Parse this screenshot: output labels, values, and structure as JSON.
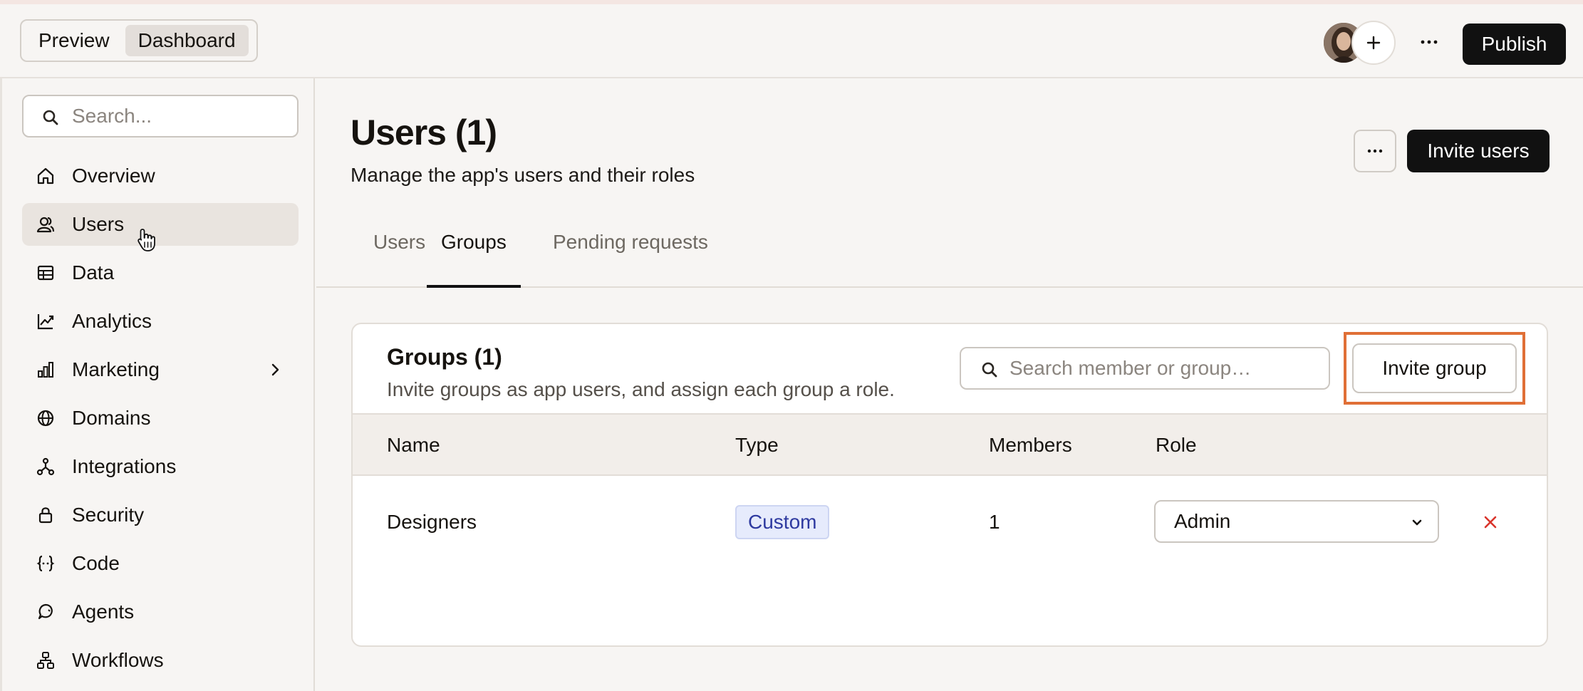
{
  "topbar": {
    "modes": [
      {
        "label": "Preview",
        "active": false
      },
      {
        "label": "Dashboard",
        "active": true
      }
    ],
    "publish_label": "Publish"
  },
  "sidebar": {
    "search_placeholder": "Search...",
    "items": [
      {
        "label": "Overview",
        "icon": "home-icon",
        "active": false
      },
      {
        "label": "Users",
        "icon": "users-icon",
        "active": true
      },
      {
        "label": "Data",
        "icon": "data-icon",
        "active": false
      },
      {
        "label": "Analytics",
        "icon": "analytics-icon",
        "active": false
      },
      {
        "label": "Marketing",
        "icon": "marketing-icon",
        "active": false,
        "has_submenu": true
      },
      {
        "label": "Domains",
        "icon": "globe-icon",
        "active": false
      },
      {
        "label": "Integrations",
        "icon": "integrations-icon",
        "active": false
      },
      {
        "label": "Security",
        "icon": "lock-icon",
        "active": false
      },
      {
        "label": "Code",
        "icon": "code-icon",
        "active": false
      },
      {
        "label": "Agents",
        "icon": "agents-icon",
        "active": false
      },
      {
        "label": "Workflows",
        "icon": "workflows-icon",
        "active": false
      }
    ]
  },
  "header": {
    "title": "Users (1)",
    "subtitle": "Manage the app's users and their roles",
    "invite_users_label": "Invite users"
  },
  "tabs": [
    {
      "label": "Users",
      "active": false
    },
    {
      "label": "Groups",
      "active": true
    },
    {
      "label": "Pending requests",
      "active": false
    }
  ],
  "groups_card": {
    "title": "Groups (1)",
    "description": "Invite groups as app users, and assign each group a role.",
    "search_placeholder": "Search member or group…",
    "invite_group_label": "Invite group",
    "columns": [
      "Name",
      "Type",
      "Members",
      "Role"
    ],
    "rows": [
      {
        "name": "Designers",
        "type": "Custom",
        "members": "1",
        "role": "Admin"
      }
    ]
  },
  "colors": {
    "accent": "#111111",
    "highlight": "#e06f36",
    "badge_bg": "#e6ebfc",
    "badge_text": "#2e3aa0",
    "delete": "#d9342b"
  }
}
